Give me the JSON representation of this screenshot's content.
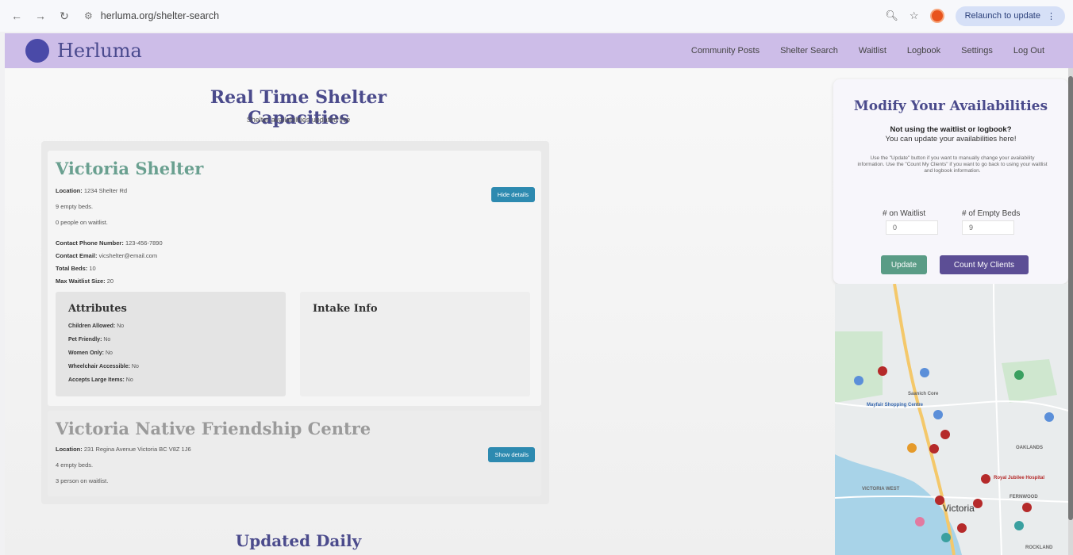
{
  "browser": {
    "url": "herluma.org/shelter-search",
    "relaunch_label": "Relaunch to update"
  },
  "header": {
    "logo_text": "Herluma",
    "nav": [
      "Community Posts",
      "Shelter Search",
      "Waitlist",
      "Logbook",
      "Settings",
      "Log Out"
    ]
  },
  "main": {
    "title": "Real Time Shelter Capacities",
    "subtitle": "Shelter availabilities updated live",
    "updated_title": "Updated Daily"
  },
  "shelters": [
    {
      "name": "Victoria Shelter",
      "location_label": "Location:",
      "location": "1234 Shelter Rd",
      "beds": "9 empty beds.",
      "waitlist": "0 people on waitlist.",
      "button": "Hide details",
      "phone_label": "Contact Phone Number:",
      "phone": "123-456-7890",
      "email_label": "Contact Email:",
      "email": "vicshelter@email.com",
      "total_beds_label": "Total Beds:",
      "total_beds": "10",
      "max_waitlist_label": "Max Waitlist Size:",
      "max_waitlist": "20",
      "attributes_title": "Attributes",
      "attributes": [
        {
          "label": "Children Allowed:",
          "value": "No"
        },
        {
          "label": "Pet Friendly:",
          "value": "No"
        },
        {
          "label": "Women Only:",
          "value": "No"
        },
        {
          "label": "Wheelchair Accessible:",
          "value": "No"
        },
        {
          "label": "Accepts Large Items:",
          "value": "No"
        }
      ],
      "intake_title": "Intake Info"
    },
    {
      "name": "Victoria Native Friendship Centre",
      "location_label": "Location:",
      "location": "231 Regina Avenue Victoria BC V8Z 1J6",
      "beds": "4 empty beds.",
      "waitlist": "3 person on waitlist.",
      "button": "Show details"
    }
  ],
  "availability": {
    "title": "Modify Your Availabilities",
    "question": "Not using the waitlist or logbook?",
    "question2": "You can update your availabilities here!",
    "description": "Use the \"Update\" button if you want to manually change your availability information. Use the \"Count My Clients\" if you want to go back to using your waitlist and logbook information.",
    "waitlist_label": "# on Waitlist",
    "waitlist_value": "0",
    "beds_label": "# of Empty Beds",
    "beds_value": "9",
    "update_button": "Update",
    "count_button": "Count My Clients"
  },
  "map": {
    "labels": [
      "Saanich Core",
      "Mayfair Shopping Centre",
      "OAKLANDS",
      "VICTORIA WEST",
      "Victoria",
      "Royal Jubilee Hospital",
      "FERNWOOD",
      "ROCKLAND"
    ]
  },
  "colors": {
    "header_bg": "#cdbde8",
    "accent": "#4b4b8c",
    "shelter_title": "#6aa090",
    "detail_button": "#2d8ab0",
    "update_button": "#5a9c86",
    "count_button": "#5c4e95"
  }
}
